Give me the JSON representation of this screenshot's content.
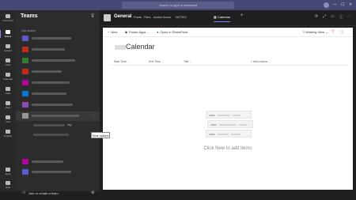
{
  "titlebar": {
    "search_placeholder": "Search or type a command",
    "minimize": "—",
    "maximize": "☐",
    "close": "✕"
  },
  "rail": {
    "items": [
      {
        "label": "New Chat",
        "icon": "new-chat-icon"
      },
      {
        "label": "Teams",
        "icon": "teams-icon"
      },
      {
        "label": "Activity",
        "icon": "bell-icon"
      },
      {
        "label": "Chat",
        "icon": "chat-icon"
      },
      {
        "label": "Calendar",
        "icon": "calendar-icon"
      },
      {
        "label": "Calls",
        "icon": "phone-icon"
      },
      {
        "label": "Files",
        "icon": "file-icon"
      },
      {
        "label": "Viva",
        "icon": "viva-icon"
      },
      {
        "label": "Insights",
        "icon": "insights-icon"
      },
      {
        "label": "Apps",
        "icon": "apps-icon"
      },
      {
        "label": "Help",
        "icon": "help-icon"
      }
    ]
  },
  "teams_panel": {
    "title": "Teams",
    "section_label": "Your teams",
    "tooltip": "More options",
    "join_label": "Join or create a team",
    "team_colors": [
      "#5d5bd4",
      "#c42b1c",
      "#2e7d32",
      "#c42b1c",
      "#b4009e",
      "#0078d4",
      "#8b4bb5",
      "#999999",
      "#777777",
      "#888888",
      "#b4009e",
      "#5d5bd4",
      "#777777"
    ],
    "teams_visible_text": [
      "ing"
    ]
  },
  "channel": {
    "title": "General",
    "tabs": [
      "Posts",
      "Files",
      "Action Items",
      "NOTES",
      "Calendar"
    ],
    "add_tab": "+",
    "active_tab": "Calendar"
  },
  "list": {
    "commands": {
      "new": "New",
      "power_apps": "Power Apps",
      "open_sharepoint": "Open in SharePoint"
    },
    "view": "Monthly View",
    "title": "Calendar",
    "columns": [
      "Start Time",
      "End Time",
      "Title",
      "Add column"
    ],
    "empty_message": "Click New to add items"
  }
}
